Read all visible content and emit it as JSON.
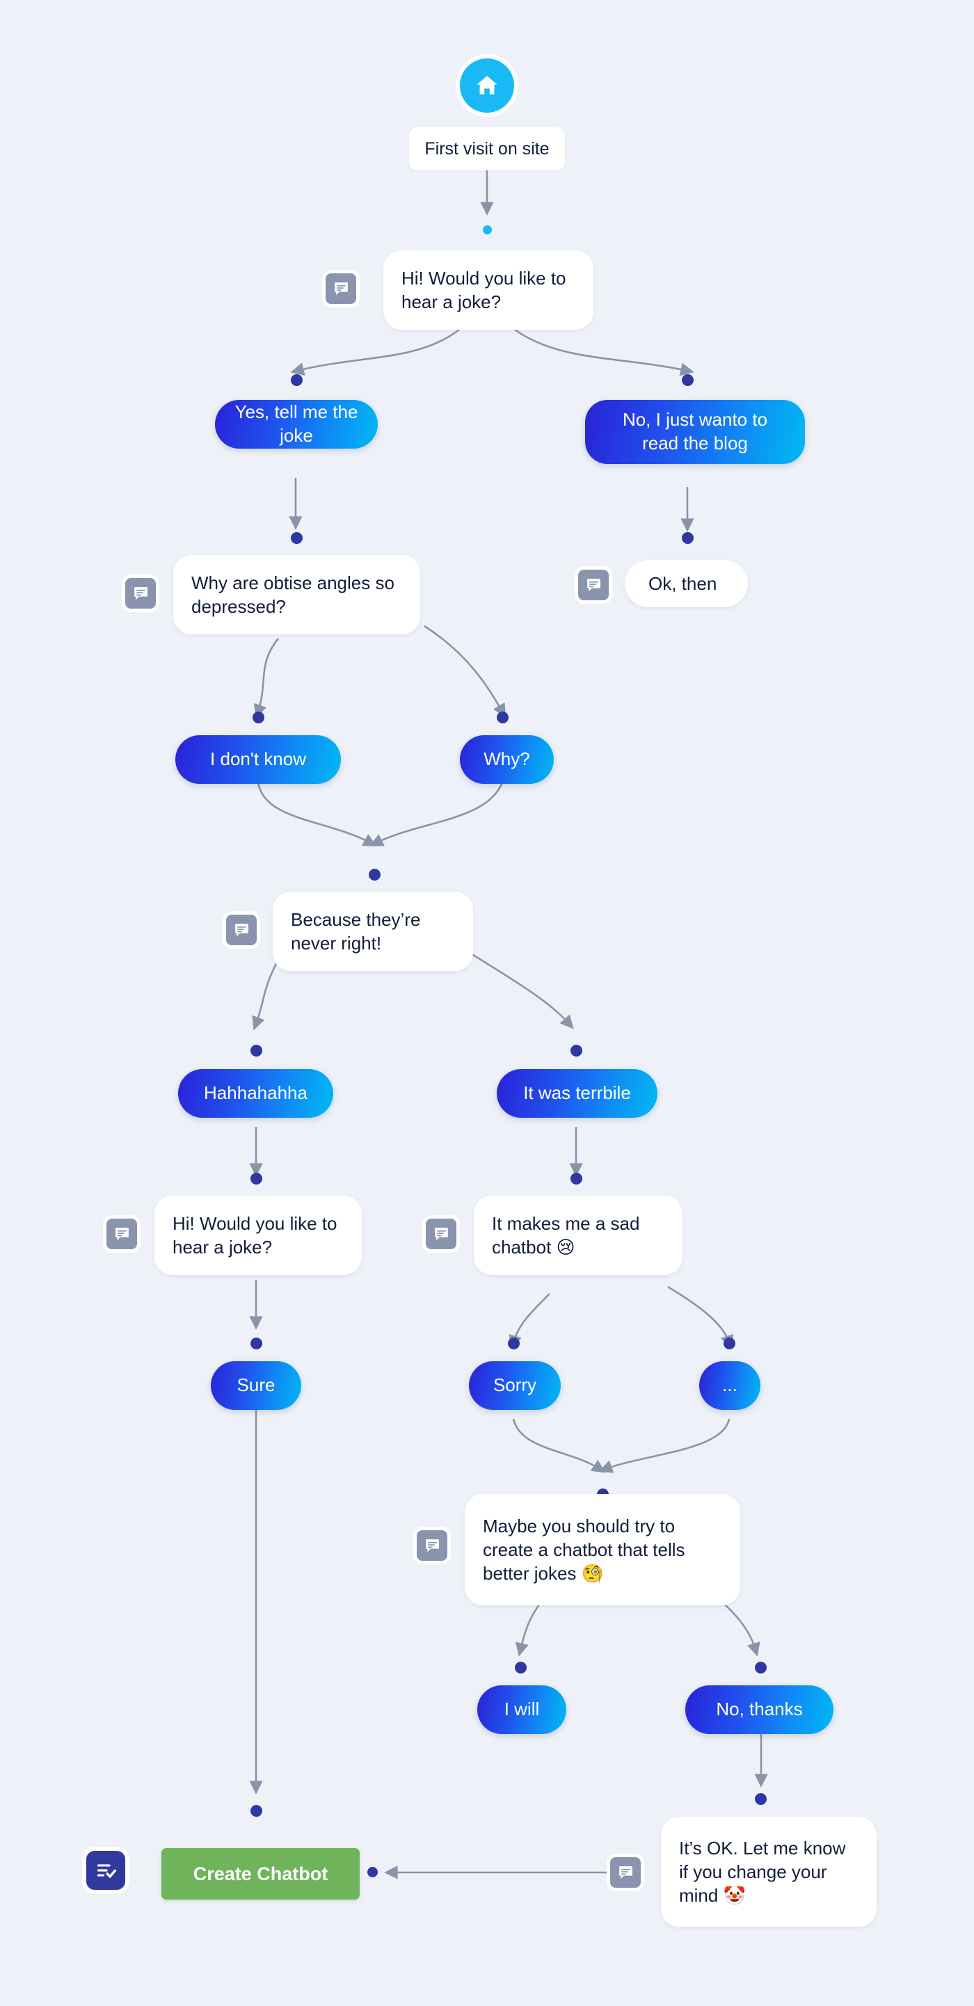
{
  "page": {
    "background_color": "#eef1f7",
    "title": "Chatbot conversation flow"
  },
  "palette": {
    "start_icon_bg": "#18b9f4",
    "chat_icon_bg": "#8b94ae",
    "button_gradient_from": "#2a22d8",
    "button_gradient_to": "#00b9f2",
    "dot_navy": "#2f37a0",
    "dot_cyan": "#18b9f4",
    "create_button_bg": "#6fb35a",
    "create_icon_bg": "#32399e",
    "edge_stroke": "#8a93a8",
    "bubble_bg": "#ffffff",
    "bubble_text": "#111d38"
  },
  "icons": {
    "start": "home-icon",
    "message": "chat-bubble-icon",
    "create": "checklist-check-icon"
  },
  "nodes": {
    "start_label": "First visit on site",
    "msg_greeting_1": "Hi! Would you like to hear a joke?",
    "btn_yes": "Yes, tell me the joke",
    "btn_no_blog": "No, I just wanto to read the blog",
    "msg_joke_question": "Why are obtise angles so depressed?",
    "msg_ok_then": "Ok, then",
    "btn_dont_know": "I don't know",
    "btn_why": "Why?",
    "msg_punchline": "Because they’re never right!",
    "btn_hahha": "Hahhahahha",
    "btn_terrible": "It was terrbile",
    "msg_greeting_2": "Hi! Would you like to hear a joke?",
    "msg_sad_chatbot": "It makes me a sad chatbot 😢",
    "btn_sure": "Sure",
    "btn_sorry": "Sorry",
    "btn_ellipsis": "...",
    "msg_better_jokes": "Maybe you should try to create a chatbot that tells better jokes 🧐",
    "btn_i_will": "I will",
    "btn_no_thanks": "No, thanks",
    "msg_its_ok": "It’s OK. Let me know if you change your mind 🤡",
    "create_chatbot": "Create Chatbot"
  }
}
